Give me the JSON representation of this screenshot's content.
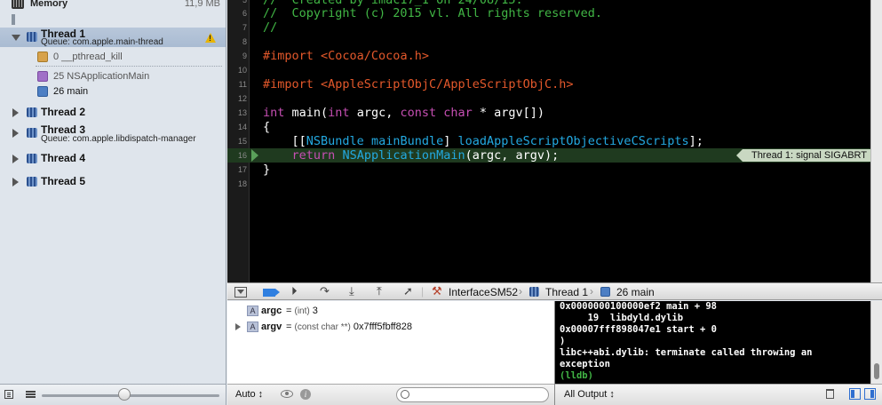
{
  "navigator": {
    "memory": {
      "label": "Memory",
      "value": "11,9 MB"
    },
    "threads": [
      {
        "name": "Thread 1",
        "queue": "Queue: com.apple.main-thread",
        "expanded": true,
        "selected": true,
        "warning": true
      },
      {
        "name": "Thread 2",
        "queue": "",
        "expanded": false
      },
      {
        "name": "Thread 3",
        "queue": "Queue: com.apple.libdispatch-manager",
        "expanded": false
      },
      {
        "name": "Thread 4",
        "queue": "",
        "expanded": false
      },
      {
        "name": "Thread 5",
        "queue": "",
        "expanded": false
      }
    ],
    "frames": [
      {
        "label": "0 __pthread_kill",
        "icon": "system-frame-icon",
        "color": "#d7a24b"
      },
      {
        "label": "25 NSApplicationMain",
        "icon": "framework-frame-icon",
        "color": "#a06fc7"
      },
      {
        "label": "26 main",
        "icon": "user-frame-icon",
        "color": "#4d7fc4"
      }
    ]
  },
  "editor": {
    "lines": [
      {
        "num": "5",
        "text": "//  Created by imac17_1 on 24/08/15."
      },
      {
        "num": "6",
        "text": "//  Copyright (c) 2015 vl. All rights reserved."
      },
      {
        "num": "7",
        "text": "//"
      },
      {
        "num": "8",
        "text": ""
      },
      {
        "num": "9",
        "kw": "#import",
        "str": " <Cocoa/Cocoa.h>"
      },
      {
        "num": "10",
        "text": ""
      },
      {
        "num": "11",
        "kw": "#import",
        "str": " <AppleScriptObjC/AppleScriptObjC.h>"
      },
      {
        "num": "12",
        "text": ""
      },
      {
        "num": "13"
      },
      {
        "num": "14",
        "text": "{"
      },
      {
        "num": "15"
      },
      {
        "num": "16"
      },
      {
        "num": "17",
        "text": "}"
      },
      {
        "num": "18",
        "text": ""
      }
    ],
    "line13": {
      "int1": "int",
      "main": " main(",
      "int2": "int",
      "argc": " argc, ",
      "const": "const",
      "sp": " ",
      "char": "char",
      "rest": " * argv[])"
    },
    "line15": {
      "indent": "    [[",
      "nsbundle": "NSBundle",
      "sp1": " ",
      "mainbundle": "mainBundle",
      "sp2": "] ",
      "load": "loadAppleScriptObjectiveCScripts",
      "end": "];"
    },
    "line16": {
      "indent": "    ",
      "ret": "return",
      "sp": " ",
      "fn": "NSApplicationMain",
      "args": "(argc, argv);"
    },
    "signal": "Thread 1: signal SIGABRT"
  },
  "debugbar": {
    "breadcrumbs": [
      "InterfaceSM52",
      "Thread 1",
      "26 main"
    ]
  },
  "variables": [
    {
      "icon": "A",
      "name": "argc",
      "eq": " = ",
      "type": "(int)",
      "value": " 3",
      "expandable": false
    },
    {
      "icon": "A",
      "name": "argv",
      "eq": " = ",
      "type": "(const char **)",
      "value": " 0x7fff5fbff828",
      "expandable": true
    }
  ],
  "console": {
    "lines": [
      "0x0000000100000ef2 main + 98",
      "     19  libdyld.dylib",
      "0x00007fff898047e1 start + 0",
      ")",
      "libc++abi.dylib: terminate called throwing an",
      "exception"
    ],
    "prompt": "(lldb)"
  },
  "varbar": {
    "scope": "Auto ↕"
  },
  "conbar": {
    "output": "All Output ↕"
  }
}
